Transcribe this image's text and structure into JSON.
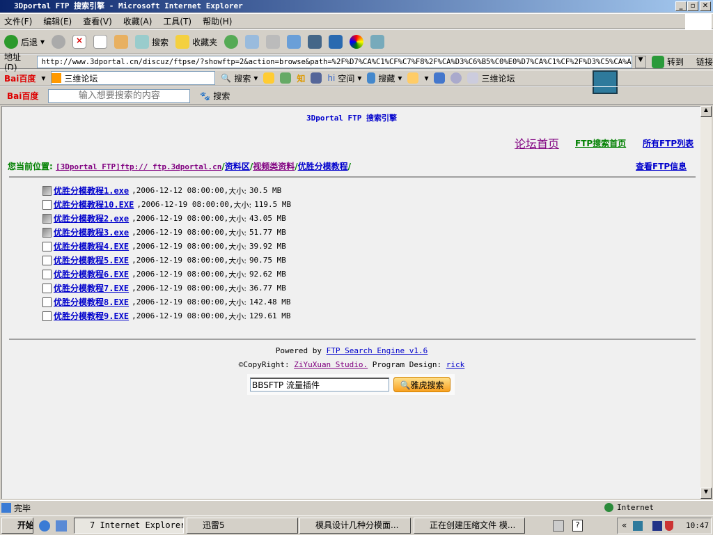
{
  "window": {
    "title": "3Dportal FTP 搜索引擎 - Microsoft Internet Explorer"
  },
  "menu": [
    "文件(F)",
    "编辑(E)",
    "查看(V)",
    "收藏(A)",
    "工具(T)",
    "帮助(H)"
  ],
  "toolbar": {
    "back": "后退",
    "search": "搜索",
    "favorites": "收藏夹"
  },
  "address": {
    "label": "地址(D)",
    "url": "http://www.3dportal.cn/discuz/ftpse/?showftp=2&action=browse&path=%2F%D7%CA%C1%CF%C7%F8%2F%CA%D3%C6%B5%C0%E0%D7%CA%C1%CF%2F%D3%C5%CA%A4%B",
    "go": "转到",
    "links": "链接"
  },
  "baidu1": {
    "logo": "Bai百度",
    "combo": "三维论坛",
    "search": "搜索",
    "space": "空间",
    "collect": "搜藏",
    "forum": "三维论坛"
  },
  "baidu2": {
    "logo": "Bai百度",
    "placeholder": "输入想要搜索的内容",
    "search": "搜索"
  },
  "page": {
    "heading": "3Dportal FTP 搜索引擎",
    "nav": {
      "forum_home": "论坛首页",
      "ftp_home": "FTP搜索首页",
      "all_ftp": "所有FTP列表"
    },
    "breadcrumb": {
      "label": "您当前位置:",
      "root": "[3Dportal FTP]ftp:// ftp.3dportal.cn",
      "p1": "资料区",
      "p2": "视频类资料",
      "p3": "优胜分模教程",
      "sep": "/"
    },
    "ftp_info": "查看FTP信息",
    "files": [
      {
        "name": "优胜分模教程1.exe",
        "date": "2006-12-12 08:00:00",
        "size": "30.5 MB",
        "icon": "exe-icon"
      },
      {
        "name": "优胜分模教程10.EXE",
        "date": "2006-12-19 08:00:00",
        "size": "119.5 MB",
        "icon": "file-icon"
      },
      {
        "name": "优胜分模教程2.exe",
        "date": "2006-12-19 08:00:00",
        "size": "43.05 MB",
        "icon": "exe-icon"
      },
      {
        "name": "优胜分模教程3.exe",
        "date": "2006-12-19 08:00:00",
        "size": "51.77 MB",
        "icon": "exe-icon"
      },
      {
        "name": "优胜分模教程4.EXE",
        "date": "2006-12-19 08:00:00",
        "size": "39.92 MB",
        "icon": "file-icon"
      },
      {
        "name": "优胜分模教程5.EXE",
        "date": "2006-12-19 08:00:00",
        "size": "90.75 MB",
        "icon": "file-icon"
      },
      {
        "name": "优胜分模教程6.EXE",
        "date": "2006-12-19 08:00:00",
        "size": "92.62 MB",
        "icon": "file-icon"
      },
      {
        "name": "优胜分模教程7.EXE",
        "date": "2006-12-19 08:00:00",
        "size": "36.77 MB",
        "icon": "file-icon"
      },
      {
        "name": "优胜分模教程8.EXE",
        "date": "2006-12-19 08:00:00",
        "size": "142.48 MB",
        "icon": "file-icon"
      },
      {
        "name": "优胜分模教程9.EXE",
        "date": "2006-12-19 08:00:00",
        "size": "129.61 MB",
        "icon": "file-icon"
      }
    ],
    "size_label": "大小:",
    "footer": {
      "powered": "Powered by ",
      "engine": "FTP Search Engine v1.6",
      "copyright": "©CopyRight: ",
      "studio": "ZiYuXuan Studio.",
      "design": " Program Design: ",
      "author": "rick"
    },
    "yahoo": {
      "value": "BBSFTP 流量插件",
      "button": "雅虎搜索"
    }
  },
  "status": {
    "text": "完毕",
    "zone": "Internet"
  },
  "taskbar": {
    "start": "开始",
    "tasks": [
      "7 Internet Explorer",
      "迅雷5",
      "模具设计几种分模面...",
      "正在创建压缩文件 模..."
    ],
    "clock": "10:47"
  }
}
